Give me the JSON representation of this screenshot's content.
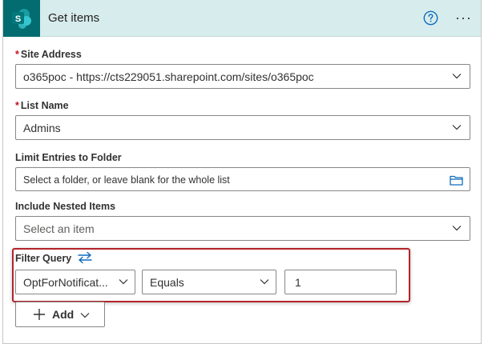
{
  "header": {
    "title": "Get items",
    "app_icon": "sharepoint-icon",
    "app_icon_letter": "S",
    "help_icon": "help-circle-icon",
    "more_icon": "more-ellipsis-icon",
    "more_glyph": "···",
    "accent": "#036c70",
    "background": "#d7ecec"
  },
  "fields": {
    "site_address": {
      "required_mark": "*",
      "label": "Site Address",
      "value": "o365poc - https://cts229051.sharepoint.com/sites/o365poc"
    },
    "list_name": {
      "required_mark": "*",
      "label": "List Name",
      "value": "Admins"
    },
    "limit_folder": {
      "label": "Limit Entries to Folder",
      "placeholder": "Select a folder, or leave blank for the whole list"
    },
    "nested_items": {
      "label": "Include Nested Items",
      "placeholder": "Select an item"
    }
  },
  "filter": {
    "label": "Filter Query",
    "field_value": "OptForNotificat...",
    "operator_value": "Equals",
    "compare_value": "1",
    "highlight_color": "#b3242a"
  },
  "add_button": {
    "label": "Add"
  }
}
